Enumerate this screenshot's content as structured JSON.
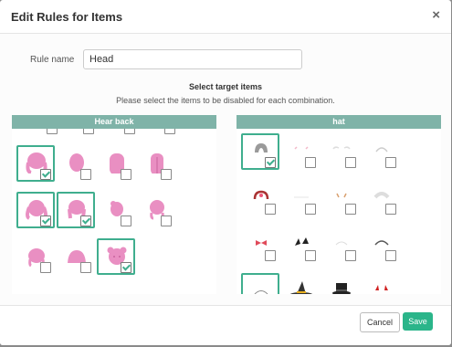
{
  "modal": {
    "title": "Edit Rules for Items",
    "close_glyph": "×",
    "rule_name_label": "Rule name",
    "rule_name_value": "Head",
    "select_title": "Select target items",
    "select_desc": "Please select the items to be disabled for each combination.",
    "left_panel_title": "Hear back",
    "right_panel_title": "hat",
    "cancel_label": "Cancel",
    "save_label": "Save"
  },
  "left_items": [
    {
      "icon": "hair-back-icon",
      "checked": true
    },
    {
      "icon": "hair-back-icon",
      "checked": false
    },
    {
      "icon": "hair-back-icon",
      "checked": false
    },
    {
      "icon": "hair-back-icon",
      "checked": false
    },
    {
      "icon": "hair-back-icon",
      "checked": true
    },
    {
      "icon": "hair-back-icon",
      "checked": true
    },
    {
      "icon": "hair-back-icon",
      "checked": false
    },
    {
      "icon": "hair-back-icon",
      "checked": false
    },
    {
      "icon": "hair-back-icon",
      "checked": false
    },
    {
      "icon": "hair-back-icon",
      "checked": false
    },
    {
      "icon": "hair-back-icon",
      "checked": true
    }
  ],
  "right_items": [
    {
      "icon": "hat-icon",
      "checked": true
    },
    {
      "icon": "hat-icon",
      "checked": false
    },
    {
      "icon": "hat-icon",
      "checked": false
    },
    {
      "icon": "hat-icon",
      "checked": false
    },
    {
      "icon": "hat-icon",
      "checked": false
    },
    {
      "icon": "hat-icon",
      "checked": false
    },
    {
      "icon": "hat-icon",
      "checked": false
    },
    {
      "icon": "hat-icon",
      "checked": false
    },
    {
      "icon": "hat-icon",
      "checked": false
    },
    {
      "icon": "hat-icon",
      "checked": false
    },
    {
      "icon": "hat-icon",
      "checked": false
    },
    {
      "icon": "hat-icon",
      "checked": false
    },
    {
      "icon": "hat-icon",
      "checked": true
    },
    {
      "icon": "hat-icon",
      "checked": false
    },
    {
      "icon": "hat-icon",
      "checked": false
    },
    {
      "icon": "hat-icon",
      "checked": false
    }
  ],
  "colors": {
    "accent": "#2bb58a",
    "panel_header": "#7fb3a8",
    "hair": "#e98fc2"
  }
}
